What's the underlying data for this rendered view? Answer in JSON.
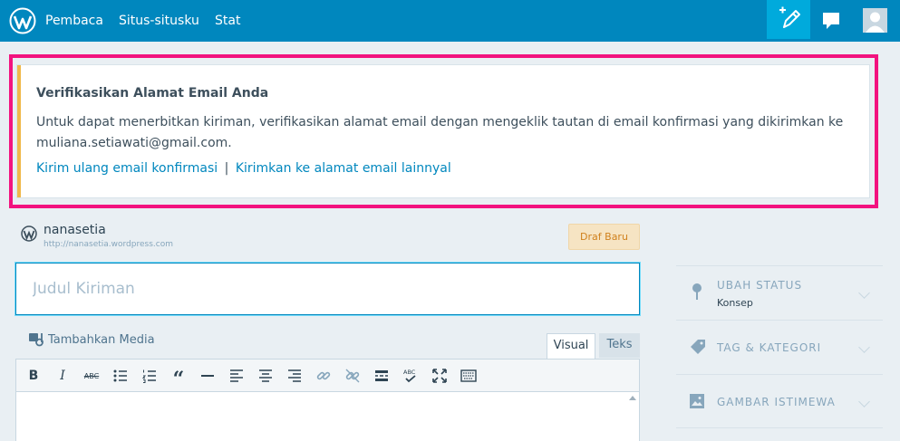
{
  "topbar": {
    "nav": [
      "Pembaca",
      "Situs-situsku",
      "Stat"
    ]
  },
  "notice": {
    "title": "Verifikasikan Alamat Email Anda",
    "body": "Untuk dapat menerbitkan kiriman, verifikasikan alamat email dengan mengeklik tautan di email konfirmasi yang dikirimkan ke muliana.setiawati@gmail.com.",
    "link_resend": "Kirim ulang email konfirmasi",
    "separator": "|",
    "link_change": "Kirimkan ke alamat email lainnyal"
  },
  "site": {
    "name": "nanasetia",
    "url": "http://nanasetia.wordpress.com",
    "status_badge": "Draf Baru"
  },
  "editor": {
    "title_placeholder": "Judul Kiriman",
    "add_media": "Tambahkan Media",
    "tab_visual": "Visual",
    "tab_text": "Teks"
  },
  "sidebar": {
    "status_label": "UBAH STATUS",
    "status_value": "Konsep",
    "tags_label": "TAG & KATEGORI",
    "featured_label": "GAMBAR ISTIMEWA"
  },
  "colors": {
    "topbar": "#0087be",
    "highlight_frame": "#f2137f",
    "notice_accent": "#f0b849"
  }
}
